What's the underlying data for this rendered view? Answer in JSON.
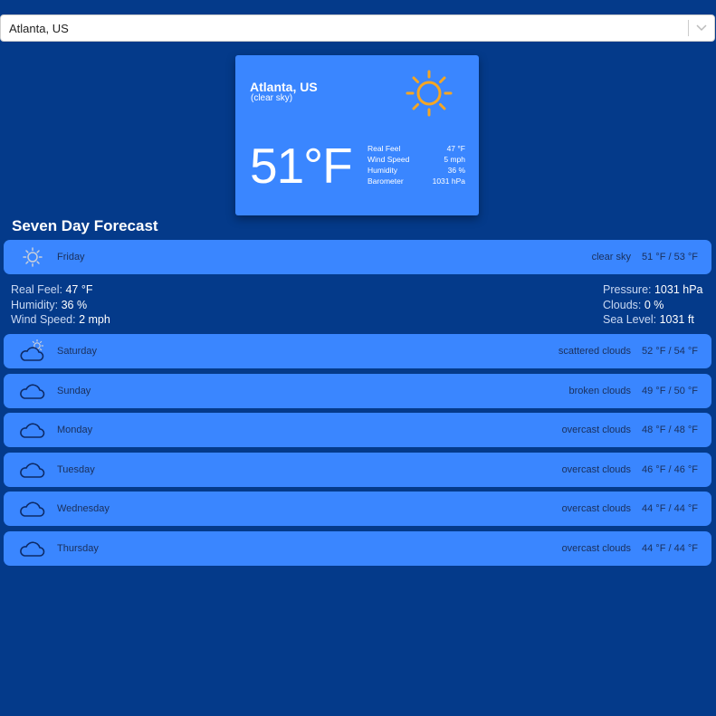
{
  "location_select": {
    "value": "Atlanta, US"
  },
  "current": {
    "city": "Atlanta, US",
    "condition": "(clear sky)",
    "temperature": "51°F",
    "stats": [
      {
        "label": "Real Feel",
        "value": "47 °F"
      },
      {
        "label": "Wind Speed",
        "value": "5 mph"
      },
      {
        "label": "Humidity",
        "value": "36 %"
      },
      {
        "label": "Barometer",
        "value": "1031 hPa"
      }
    ]
  },
  "forecast_title": "Seven Day Forecast",
  "forecast": [
    {
      "day": "Friday",
      "description": "clear sky",
      "temps": "51 °F / 53 °F",
      "icon": "sun-icon"
    },
    {
      "day": "Saturday",
      "description": "scattered clouds",
      "temps": "52 °F / 54 °F",
      "icon": "cloud-sun-icon"
    },
    {
      "day": "Sunday",
      "description": "broken clouds",
      "temps": "49 °F / 50 °F",
      "icon": "cloud-icon"
    },
    {
      "day": "Monday",
      "description": "overcast clouds",
      "temps": "48 °F / 48 °F",
      "icon": "cloud-icon"
    },
    {
      "day": "Tuesday",
      "description": "overcast clouds",
      "temps": "46 °F / 46 °F",
      "icon": "cloud-icon"
    },
    {
      "day": "Wednesday",
      "description": "overcast clouds",
      "temps": "44 °F / 44 °F",
      "icon": "cloud-icon"
    },
    {
      "day": "Thursday",
      "description": "overcast clouds",
      "temps": "44 °F / 44 °F",
      "icon": "cloud-icon"
    }
  ],
  "expanded_details": {
    "left": [
      {
        "label": "Real Feel:",
        "value": "47 °F"
      },
      {
        "label": "Humidity:",
        "value": "36 %"
      },
      {
        "label": "Wind Speed:",
        "value": "2 mph"
      }
    ],
    "right": [
      {
        "label": "Pressure:",
        "value": "1031 hPa"
      },
      {
        "label": "Clouds:",
        "value": "0 %"
      },
      {
        "label": "Sea Level:",
        "value": "1031 ft"
      }
    ]
  },
  "colors": {
    "background": "#043a8a",
    "card": "#3a86ff",
    "sun": "#f5a623"
  }
}
